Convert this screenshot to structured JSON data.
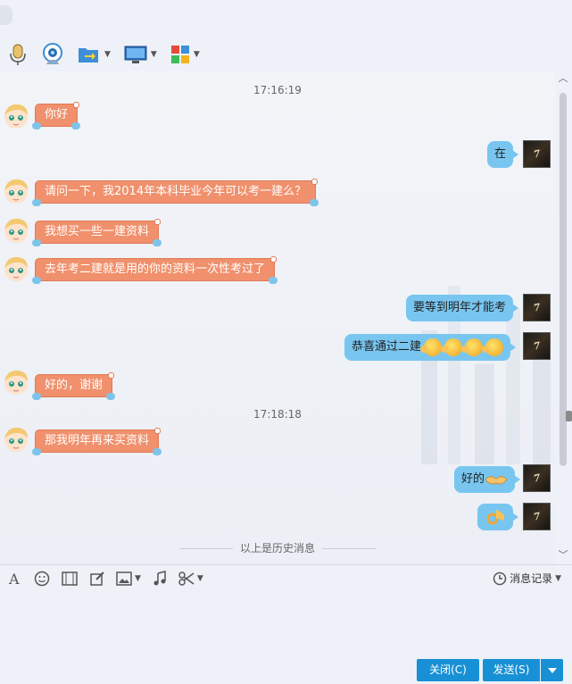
{
  "toolbar": {
    "items": [
      {
        "icon": "microphone-icon"
      },
      {
        "icon": "webcam-icon"
      },
      {
        "icon": "folder-transfer-icon"
      },
      {
        "icon": "remote-desktop-icon"
      },
      {
        "icon": "apps-grid-icon"
      }
    ]
  },
  "messages": [
    {
      "type": "timestamp",
      "text": "17:16:19"
    },
    {
      "side": "left",
      "text": "你好"
    },
    {
      "side": "right",
      "text": "在"
    },
    {
      "side": "left",
      "text": "请问一下，我2014年本科毕业今年可以考一建么？"
    },
    {
      "side": "left",
      "text": "我想买一些一建资料"
    },
    {
      "side": "left",
      "text": "去年考二建就是用的你的资料一次性考过了"
    },
    {
      "side": "right",
      "text": "要等到明年才能考"
    },
    {
      "side": "right",
      "text": "恭喜通过二建",
      "emoji": "kiss-emoji",
      "emoji_count": 4
    },
    {
      "side": "left",
      "text": "好的，谢谢"
    },
    {
      "type": "timestamp",
      "text": "17:18:18"
    },
    {
      "side": "left",
      "text": "那我明年再来买资料"
    },
    {
      "side": "right",
      "text": "好的",
      "emoji": "handshake-emoji"
    },
    {
      "side": "right",
      "text": "",
      "emoji": "ok-hand-emoji"
    }
  ],
  "history_divider": "以上是历史消息",
  "format_toolbar": {
    "history_label": "消息记录"
  },
  "buttons": {
    "close": "关闭(C)",
    "send": "发送(S)"
  },
  "colors": {
    "left_bubble": "#f0906c",
    "right_bubble": "#78c6f0",
    "button_blue": "#1890d6"
  }
}
